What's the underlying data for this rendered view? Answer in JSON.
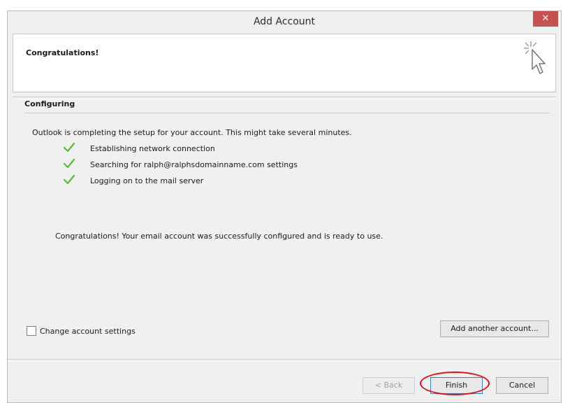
{
  "window": {
    "title": "Add Account",
    "close_symbol": "✕"
  },
  "header": {
    "title": "Congratulations!",
    "icon": "cursor-sparkle-icon"
  },
  "section": {
    "label": "Configuring",
    "intro": "Outlook is completing the setup for your account. This might take several minutes.",
    "steps": [
      {
        "label": "Establishing network connection",
        "icon": "check-icon",
        "status_color": "#5ab73b"
      },
      {
        "label": "Searching for ralph@ralphsdomainname.com settings",
        "icon": "check-icon",
        "status_color": "#5ab73b"
      },
      {
        "label": "Logging on to the mail server",
        "icon": "check-icon",
        "status_color": "#5ab73b"
      }
    ],
    "success_message": "Congratulations! Your email account was successfully configured and is ready to use."
  },
  "options": {
    "change_settings_label": "Change account settings",
    "change_settings_checked": false,
    "add_another_label": "Add another account..."
  },
  "footer": {
    "back_label": "< Back",
    "finish_label": "Finish",
    "cancel_label": "Cancel"
  },
  "colors": {
    "close_button": "#c75050",
    "check": "#5ab73b",
    "highlight": "#e0101a"
  }
}
